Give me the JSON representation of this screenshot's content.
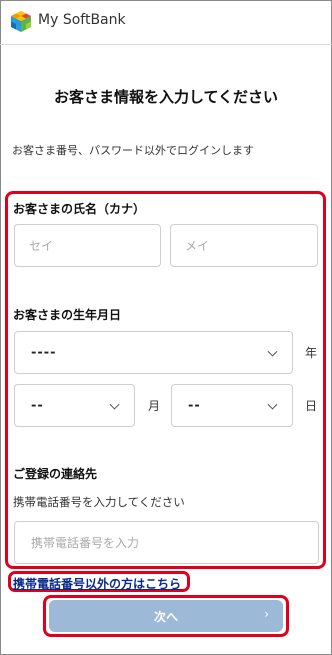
{
  "header": {
    "app_title": "My SoftBank"
  },
  "page": {
    "title": "お客さま情報を入力してください",
    "subtitle": "お客さま番号、パスワード以外でログインします"
  },
  "name_section": {
    "label": "お客さまの氏名（カナ）",
    "sei_placeholder": "セイ",
    "mei_placeholder": "メイ"
  },
  "birth_section": {
    "label": "お客さまの生年月日",
    "year_value": "----",
    "year_unit": "年",
    "month_value": "--",
    "month_unit": "月",
    "day_value": "--",
    "day_unit": "日"
  },
  "contact_section": {
    "label": "ご登録の連絡先",
    "sublabel": "携帯電話番号を入力してください",
    "phone_placeholder": "携帯電話番号を入力"
  },
  "links": {
    "other_than_mobile": "携帯電話番号以外の方はこちら"
  },
  "buttons": {
    "next_label": "次へ",
    "next_arrow": "›"
  },
  "colors": {
    "highlight": "#e0001b",
    "next_button": "#9cb9d8",
    "link": "#0a2a8a"
  },
  "icons": {
    "logo": "softbank-cube-logo",
    "select": "chevron-down-icon",
    "next": "chevron-right-icon"
  }
}
